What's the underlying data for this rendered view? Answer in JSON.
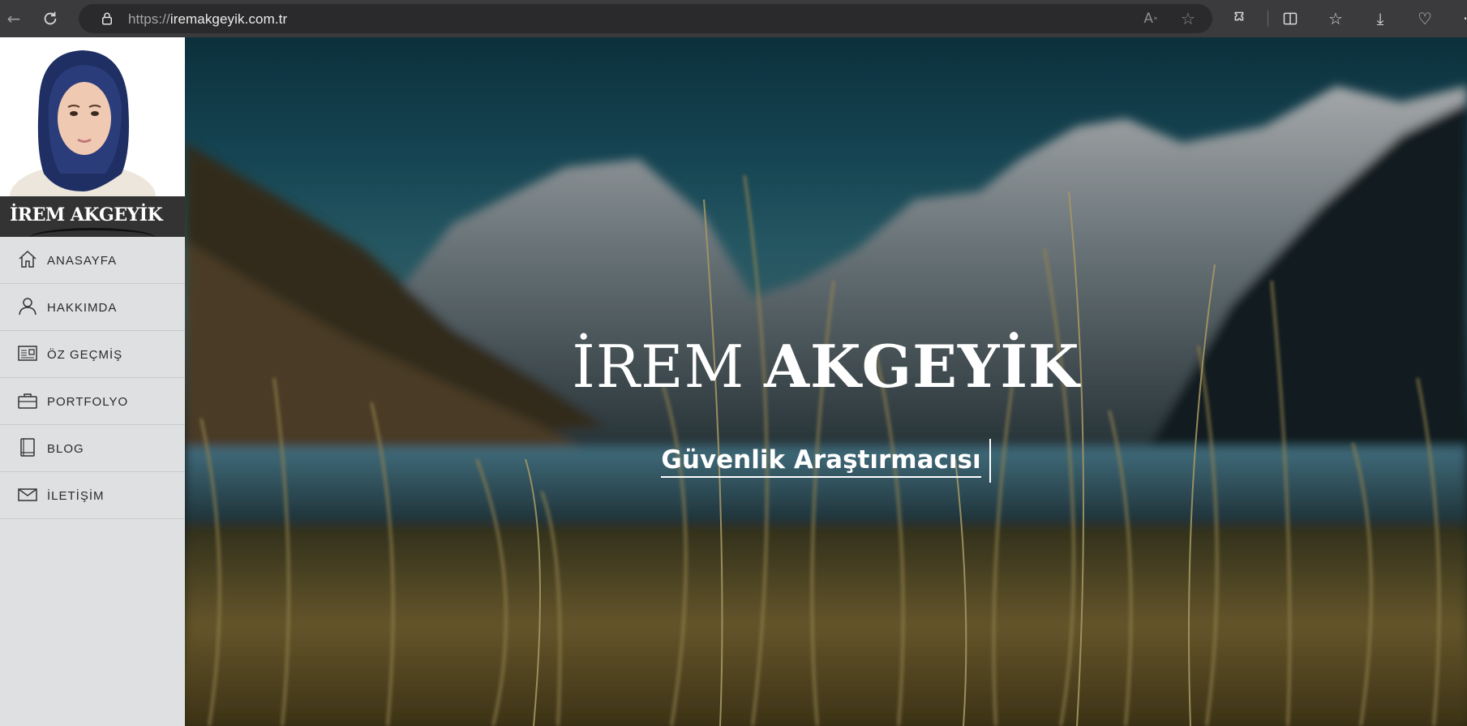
{
  "browser": {
    "url_prefix": "https://",
    "url_host": "iremakgeyik.com.tr"
  },
  "sidebar": {
    "name": "İREM AKGEYİK",
    "menu": [
      {
        "label": "ANASAYFA",
        "icon": "home-icon"
      },
      {
        "label": "HAKKIMDA",
        "icon": "user-icon"
      },
      {
        "label": "ÖZ GEÇMİŞ",
        "icon": "resume-icon"
      },
      {
        "label": "PORTFOLYO",
        "icon": "briefcase-icon"
      },
      {
        "label": "BLOG",
        "icon": "book-icon"
      },
      {
        "label": "İLETİŞİM",
        "icon": "mail-icon"
      }
    ]
  },
  "hero": {
    "name_first": "İREM",
    "name_last": "AKGEYİK",
    "subtitle": "Güvenlik Araştırmacısı"
  }
}
